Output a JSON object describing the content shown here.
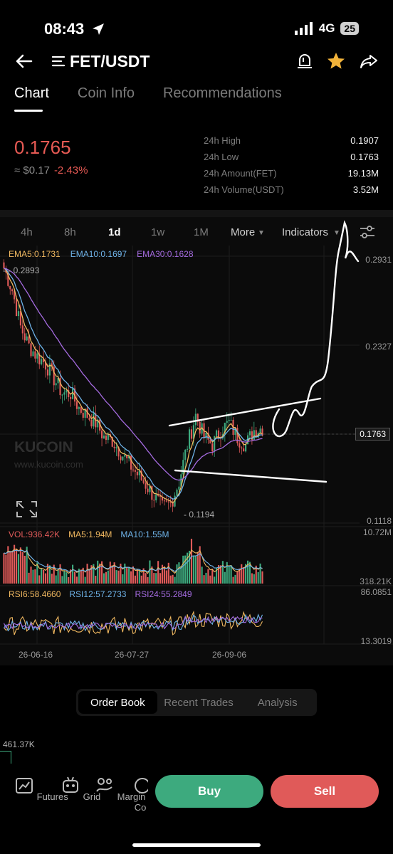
{
  "status": {
    "time": "08:43",
    "network": "4G",
    "battery": "25"
  },
  "header": {
    "pair": "FET/USDT"
  },
  "tabs": [
    "Chart",
    "Coin Info",
    "Recommendations"
  ],
  "price": {
    "last": "0.1765",
    "fiat": "≈ $0.17",
    "change": "-2.43%"
  },
  "stats": [
    {
      "label": "24h High",
      "value": "0.1907"
    },
    {
      "label": "24h Low",
      "value": "0.1763"
    },
    {
      "label": "24h Amount(FET)",
      "value": "19.13M"
    },
    {
      "label": "24h Volume(USDT)",
      "value": "3.52M"
    }
  ],
  "timeframes": {
    "t4h": "4h",
    "t8h": "8h",
    "t1d": "1d",
    "t1w": "1w",
    "t1M": "1M",
    "more": "More",
    "indicators": "Indicators"
  },
  "ema": {
    "ema5": "EMA5:0.1731",
    "ema10": "EMA10:0.1697",
    "ema30": "EMA30:0.1628"
  },
  "price_axis": {
    "p1": "0.2931",
    "p2": "0.2327",
    "current": "0.1763",
    "p3": "0.1118",
    "high_marker": "0.2893",
    "low_marker": "0.1194"
  },
  "watermark": {
    "brand": "KUCOIN",
    "url": "www.kucoin.com"
  },
  "volume": {
    "vol": "VOL:936.42K",
    "ma5": "MA5:1.94M",
    "ma10": "MA10:1.55M",
    "top": "10.72M",
    "bottom": "318.21K"
  },
  "rsi": {
    "rsi6": "RSI6:58.4660",
    "rsi12": "RSI12:57.2733",
    "rsi24": "RSI24:55.2849",
    "top": "86.0851",
    "bottom": "13.3019"
  },
  "dates": [
    "26-06-16",
    "26-07-27",
    "26-09-06"
  ],
  "bottom_tabs": [
    "Order Book",
    "Recent Trades",
    "Analysis"
  ],
  "order_book_size": "461.37K",
  "bottom_nav": [
    "Futures",
    "Grid",
    "Margin",
    "Co"
  ],
  "buttons": {
    "buy": "Buy",
    "sell": "Sell"
  },
  "colors": {
    "up": "#3daa7e",
    "down": "#e05a59",
    "ema5": "#f0b860",
    "ema10": "#6fb3e8",
    "ema30": "#a56be0"
  },
  "chart_data": {
    "type": "candlestick",
    "interval": "1d",
    "x_labels": [
      "26-06-16",
      "26-07-27",
      "26-09-06"
    ],
    "close_path": [
      0.285,
      0.27,
      0.245,
      0.232,
      0.225,
      0.22,
      0.21,
      0.2,
      0.2,
      0.19,
      0.185,
      0.18,
      0.17,
      0.168,
      0.16,
      0.152,
      0.145,
      0.138,
      0.13,
      0.122,
      0.125,
      0.14,
      0.165,
      0.185,
      0.17,
      0.165,
      0.175,
      0.18,
      0.17,
      0.165,
      0.175,
      0.1765
    ],
    "ylim": [
      0.1118,
      0.2931
    ]
  }
}
